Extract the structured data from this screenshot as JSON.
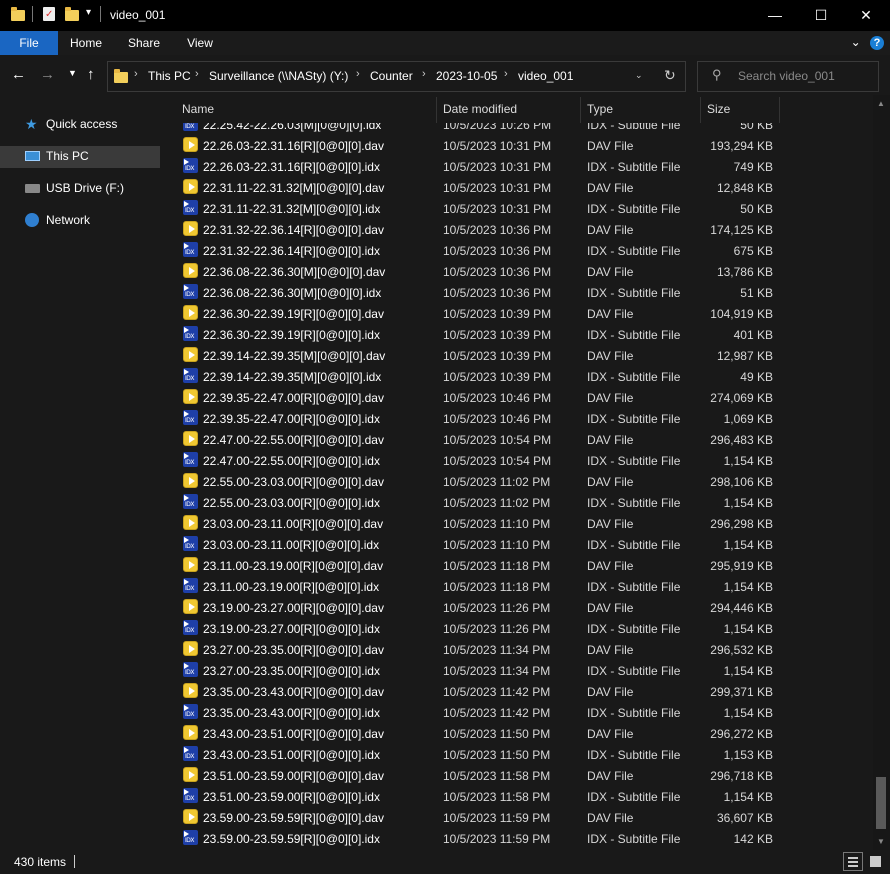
{
  "window": {
    "title": "video_001",
    "minimize": "—",
    "maximize": "☐",
    "close": "✕"
  },
  "ribbon": {
    "tabs": [
      "File",
      "Home",
      "Share",
      "View"
    ],
    "expand": "⌄",
    "help": "?"
  },
  "address": {
    "crumbs": [
      "This PC",
      "Surveillance (\\\\NASty) (Y:)",
      "Counter",
      "2023-10-05",
      "video_001"
    ],
    "search_placeholder": "Search video_001"
  },
  "navpane": {
    "items": [
      {
        "label": "Quick access",
        "icon": "star-icon"
      },
      {
        "label": "This PC",
        "icon": "computer-icon",
        "selected": true
      },
      {
        "label": "USB Drive (F:)",
        "icon": "usb-drive-icon"
      },
      {
        "label": "Network",
        "icon": "network-icon"
      }
    ]
  },
  "columns": {
    "name": "Name",
    "date": "Date modified",
    "type": "Type",
    "size": "Size"
  },
  "files": [
    {
      "name": "22.25.42-22.26.03[M][0@0][0].idx",
      "date": "10/5/2023 10:26 PM",
      "type": "IDX - Subtitle File",
      "size": "50 KB",
      "kind": "idx"
    },
    {
      "name": "22.26.03-22.31.16[R][0@0][0].dav",
      "date": "10/5/2023 10:31 PM",
      "type": "DAV File",
      "size": "193,294 KB",
      "kind": "dav"
    },
    {
      "name": "22.26.03-22.31.16[R][0@0][0].idx",
      "date": "10/5/2023 10:31 PM",
      "type": "IDX - Subtitle File",
      "size": "749 KB",
      "kind": "idx"
    },
    {
      "name": "22.31.11-22.31.32[M][0@0][0].dav",
      "date": "10/5/2023 10:31 PM",
      "type": "DAV File",
      "size": "12,848 KB",
      "kind": "dav"
    },
    {
      "name": "22.31.11-22.31.32[M][0@0][0].idx",
      "date": "10/5/2023 10:31 PM",
      "type": "IDX - Subtitle File",
      "size": "50 KB",
      "kind": "idx"
    },
    {
      "name": "22.31.32-22.36.14[R][0@0][0].dav",
      "date": "10/5/2023 10:36 PM",
      "type": "DAV File",
      "size": "174,125 KB",
      "kind": "dav"
    },
    {
      "name": "22.31.32-22.36.14[R][0@0][0].idx",
      "date": "10/5/2023 10:36 PM",
      "type": "IDX - Subtitle File",
      "size": "675 KB",
      "kind": "idx"
    },
    {
      "name": "22.36.08-22.36.30[M][0@0][0].dav",
      "date": "10/5/2023 10:36 PM",
      "type": "DAV File",
      "size": "13,786 KB",
      "kind": "dav"
    },
    {
      "name": "22.36.08-22.36.30[M][0@0][0].idx",
      "date": "10/5/2023 10:36 PM",
      "type": "IDX - Subtitle File",
      "size": "51 KB",
      "kind": "idx"
    },
    {
      "name": "22.36.30-22.39.19[R][0@0][0].dav",
      "date": "10/5/2023 10:39 PM",
      "type": "DAV File",
      "size": "104,919 KB",
      "kind": "dav"
    },
    {
      "name": "22.36.30-22.39.19[R][0@0][0].idx",
      "date": "10/5/2023 10:39 PM",
      "type": "IDX - Subtitle File",
      "size": "401 KB",
      "kind": "idx"
    },
    {
      "name": "22.39.14-22.39.35[M][0@0][0].dav",
      "date": "10/5/2023 10:39 PM",
      "type": "DAV File",
      "size": "12,987 KB",
      "kind": "dav"
    },
    {
      "name": "22.39.14-22.39.35[M][0@0][0].idx",
      "date": "10/5/2023 10:39 PM",
      "type": "IDX - Subtitle File",
      "size": "49 KB",
      "kind": "idx"
    },
    {
      "name": "22.39.35-22.47.00[R][0@0][0].dav",
      "date": "10/5/2023 10:46 PM",
      "type": "DAV File",
      "size": "274,069 KB",
      "kind": "dav"
    },
    {
      "name": "22.39.35-22.47.00[R][0@0][0].idx",
      "date": "10/5/2023 10:46 PM",
      "type": "IDX - Subtitle File",
      "size": "1,069 KB",
      "kind": "idx"
    },
    {
      "name": "22.47.00-22.55.00[R][0@0][0].dav",
      "date": "10/5/2023 10:54 PM",
      "type": "DAV File",
      "size": "296,483 KB",
      "kind": "dav"
    },
    {
      "name": "22.47.00-22.55.00[R][0@0][0].idx",
      "date": "10/5/2023 10:54 PM",
      "type": "IDX - Subtitle File",
      "size": "1,154 KB",
      "kind": "idx"
    },
    {
      "name": "22.55.00-23.03.00[R][0@0][0].dav",
      "date": "10/5/2023 11:02 PM",
      "type": "DAV File",
      "size": "298,106 KB",
      "kind": "dav"
    },
    {
      "name": "22.55.00-23.03.00[R][0@0][0].idx",
      "date": "10/5/2023 11:02 PM",
      "type": "IDX - Subtitle File",
      "size": "1,154 KB",
      "kind": "idx"
    },
    {
      "name": "23.03.00-23.11.00[R][0@0][0].dav",
      "date": "10/5/2023 11:10 PM",
      "type": "DAV File",
      "size": "296,298 KB",
      "kind": "dav"
    },
    {
      "name": "23.03.00-23.11.00[R][0@0][0].idx",
      "date": "10/5/2023 11:10 PM",
      "type": "IDX - Subtitle File",
      "size": "1,154 KB",
      "kind": "idx"
    },
    {
      "name": "23.11.00-23.19.00[R][0@0][0].dav",
      "date": "10/5/2023 11:18 PM",
      "type": "DAV File",
      "size": "295,919 KB",
      "kind": "dav"
    },
    {
      "name": "23.11.00-23.19.00[R][0@0][0].idx",
      "date": "10/5/2023 11:18 PM",
      "type": "IDX - Subtitle File",
      "size": "1,154 KB",
      "kind": "idx"
    },
    {
      "name": "23.19.00-23.27.00[R][0@0][0].dav",
      "date": "10/5/2023 11:26 PM",
      "type": "DAV File",
      "size": "294,446 KB",
      "kind": "dav"
    },
    {
      "name": "23.19.00-23.27.00[R][0@0][0].idx",
      "date": "10/5/2023 11:26 PM",
      "type": "IDX - Subtitle File",
      "size": "1,154 KB",
      "kind": "idx"
    },
    {
      "name": "23.27.00-23.35.00[R][0@0][0].dav",
      "date": "10/5/2023 11:34 PM",
      "type": "DAV File",
      "size": "296,532 KB",
      "kind": "dav"
    },
    {
      "name": "23.27.00-23.35.00[R][0@0][0].idx",
      "date": "10/5/2023 11:34 PM",
      "type": "IDX - Subtitle File",
      "size": "1,154 KB",
      "kind": "idx"
    },
    {
      "name": "23.35.00-23.43.00[R][0@0][0].dav",
      "date": "10/5/2023 11:42 PM",
      "type": "DAV File",
      "size": "299,371 KB",
      "kind": "dav"
    },
    {
      "name": "23.35.00-23.43.00[R][0@0][0].idx",
      "date": "10/5/2023 11:42 PM",
      "type": "IDX - Subtitle File",
      "size": "1,154 KB",
      "kind": "idx"
    },
    {
      "name": "23.43.00-23.51.00[R][0@0][0].dav",
      "date": "10/5/2023 11:50 PM",
      "type": "DAV File",
      "size": "296,272 KB",
      "kind": "dav"
    },
    {
      "name": "23.43.00-23.51.00[R][0@0][0].idx",
      "date": "10/5/2023 11:50 PM",
      "type": "IDX - Subtitle File",
      "size": "1,153 KB",
      "kind": "idx"
    },
    {
      "name": "23.51.00-23.59.00[R][0@0][0].dav",
      "date": "10/5/2023 11:58 PM",
      "type": "DAV File",
      "size": "296,718 KB",
      "kind": "dav"
    },
    {
      "name": "23.51.00-23.59.00[R][0@0][0].idx",
      "date": "10/5/2023 11:58 PM",
      "type": "IDX - Subtitle File",
      "size": "1,154 KB",
      "kind": "idx"
    },
    {
      "name": "23.59.00-23.59.59[R][0@0][0].dav",
      "date": "10/5/2023 11:59 PM",
      "type": "DAV File",
      "size": "36,607 KB",
      "kind": "dav"
    },
    {
      "name": "23.59.00-23.59.59[R][0@0][0].idx",
      "date": "10/5/2023 11:59 PM",
      "type": "IDX - Subtitle File",
      "size": "142 KB",
      "kind": "idx"
    }
  ],
  "status": {
    "item_count": "430 items"
  }
}
